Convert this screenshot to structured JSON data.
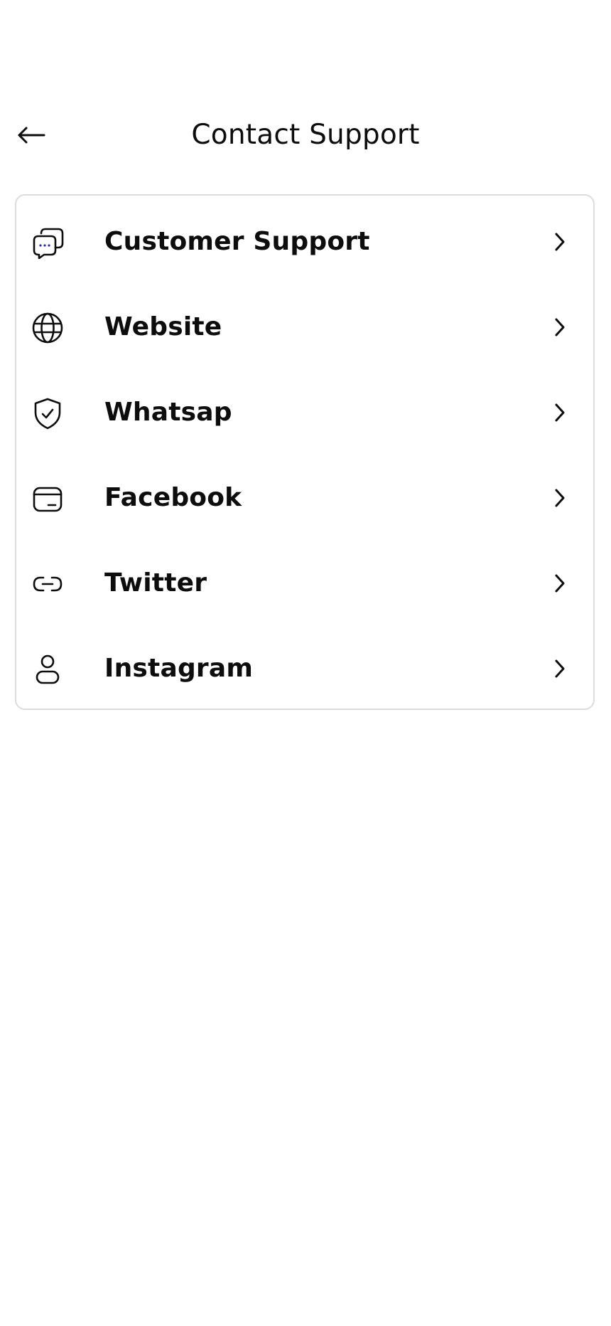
{
  "header": {
    "title": "Contact Support",
    "back_icon": "arrow-left-icon"
  },
  "contacts": {
    "items": [
      {
        "label": "Customer Support",
        "icon": "chat-bubbles-icon"
      },
      {
        "label": "Website",
        "icon": "globe-icon"
      },
      {
        "label": "Whatsap",
        "icon": "shield-check-icon"
      },
      {
        "label": "Facebook",
        "icon": "card-icon"
      },
      {
        "label": "Twitter",
        "icon": "link-icon"
      },
      {
        "label": "Instagram",
        "icon": "user-icon"
      }
    ],
    "chevron_icon": "chevron-right-icon"
  },
  "colors": {
    "text": "#0d0d0d",
    "card_border": "#dcdcdc",
    "background": "#ffffff",
    "chat_dots": "#2b2f8f"
  }
}
